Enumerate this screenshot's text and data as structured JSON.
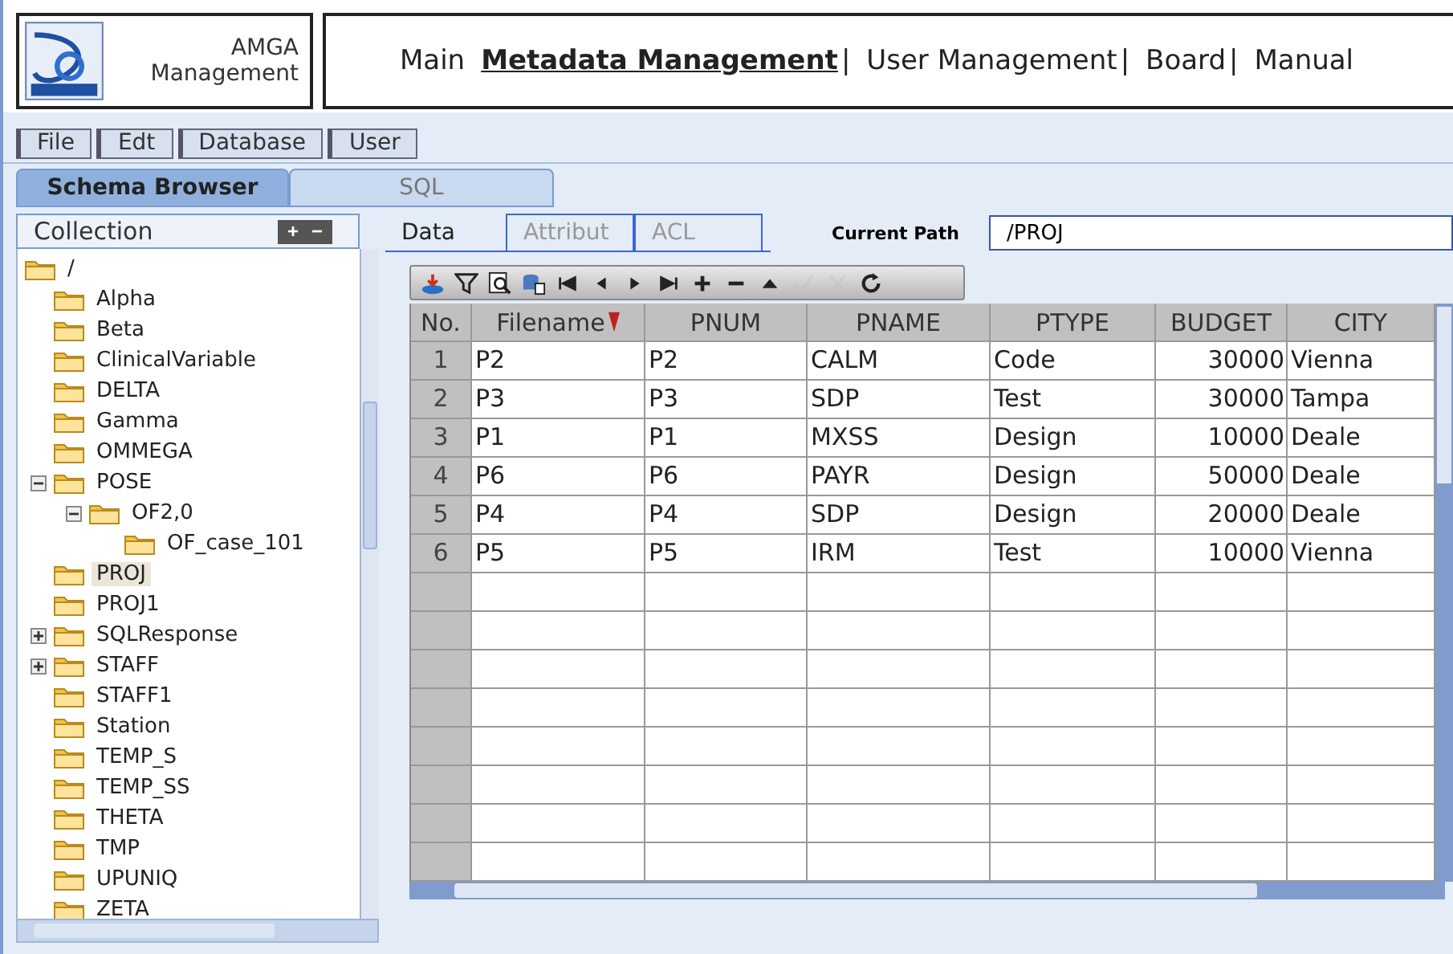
{
  "logo": {
    "title": "AMGA",
    "subtitle": "Management"
  },
  "nav": [
    {
      "kind": "link",
      "label": "Main",
      "selected": false
    },
    {
      "kind": "link",
      "label": "Metadata Management",
      "selected": true
    },
    {
      "kind": "separator",
      "label": "|"
    },
    {
      "kind": "link",
      "label": "User Management",
      "selected": false
    },
    {
      "kind": "separator",
      "label": "|"
    },
    {
      "kind": "link",
      "label": "Board",
      "selected": false
    },
    {
      "kind": "separator",
      "label": "|"
    },
    {
      "kind": "link",
      "label": "Manual",
      "selected": false
    }
  ],
  "menu": [
    "File",
    "Edt",
    "Database",
    "User"
  ],
  "tabs": [
    {
      "label": "Schema Browser",
      "selected": true
    },
    {
      "label": "SQL",
      "selected": false
    }
  ],
  "collection": {
    "title": "Collection",
    "expand_all": "+",
    "collapse_all": "−",
    "tree": [
      {
        "label": "/",
        "selected": false,
        "children": [
          {
            "label": "Alpha",
            "selected": false
          },
          {
            "label": "Beta",
            "selected": false
          },
          {
            "label": "ClinicalVariable",
            "selected": false
          },
          {
            "label": "DELTA",
            "selected": false
          },
          {
            "label": "Gamma",
            "selected": false
          },
          {
            "label": "OMMEGA",
            "selected": false
          },
          {
            "label": "POSE",
            "expanded": true,
            "selected": false,
            "children": [
              {
                "label": "OF2,0",
                "expanded": true,
                "selected": false,
                "children": [
                  {
                    "label": "OF_case_101",
                    "selected": false
                  }
                ]
              }
            ]
          },
          {
            "label": "PROJ",
            "selected": true
          },
          {
            "label": "PROJ1",
            "selected": false
          },
          {
            "label": "SQLResponse",
            "expanded": false,
            "selected": false
          },
          {
            "label": "STAFF",
            "expanded": false,
            "selected": false
          },
          {
            "label": "STAFF1",
            "selected": false
          },
          {
            "label": "Station",
            "selected": false
          },
          {
            "label": "TEMP_S",
            "selected": false
          },
          {
            "label": "TEMP_SS",
            "selected": false
          },
          {
            "label": "THETA",
            "selected": false
          },
          {
            "label": "TMP",
            "selected": false
          },
          {
            "label": "UPUNIQ",
            "selected": false
          },
          {
            "label": "ZETA",
            "selected": false
          }
        ]
      }
    ]
  },
  "subtabs": [
    {
      "label": "Data",
      "selected": true
    },
    {
      "label": "Attribut",
      "selected": false
    },
    {
      "label": "ACL",
      "selected": false
    }
  ],
  "path": {
    "label": "Current Path",
    "value": "/PROJ"
  },
  "toolbar": [
    {
      "kind": "import",
      "disabled": false
    },
    {
      "kind": "filter",
      "disabled": false
    },
    {
      "kind": "preview",
      "disabled": false
    },
    {
      "kind": "database",
      "disabled": false
    },
    {
      "kind": "first",
      "disabled": false
    },
    {
      "kind": "prev",
      "disabled": false
    },
    {
      "kind": "next",
      "disabled": false
    },
    {
      "kind": "last",
      "disabled": false
    },
    {
      "kind": "add",
      "disabled": false
    },
    {
      "kind": "remove",
      "disabled": false
    },
    {
      "kind": "up",
      "disabled": false
    },
    {
      "kind": "confirm",
      "disabled": true
    },
    {
      "kind": "cancel",
      "disabled": true
    },
    {
      "kind": "refresh",
      "disabled": false
    }
  ],
  "table": {
    "columns": [
      {
        "label": "No.",
        "sorted": false
      },
      {
        "label": "Filename",
        "sorted": true
      },
      {
        "label": "PNUM",
        "sorted": false
      },
      {
        "label": "PNAME",
        "sorted": false
      },
      {
        "label": "PTYPE",
        "sorted": false
      },
      {
        "label": "BUDGET",
        "sorted": false
      },
      {
        "label": "CITY",
        "sorted": false
      }
    ],
    "rows": [
      [
        "1",
        "P2",
        "P2",
        "CALM",
        "Code",
        "30000",
        "Vienna"
      ],
      [
        "2",
        "P3",
        "P3",
        "SDP",
        "Test",
        "30000",
        "Tampa"
      ],
      [
        "3",
        "P1",
        "P1",
        "MXSS",
        "Design",
        "10000",
        "Deale"
      ],
      [
        "4",
        "P6",
        "P6",
        "PAYR",
        "Design",
        "50000",
        "Deale"
      ],
      [
        "5",
        "P4",
        "P4",
        "SDP",
        "Design",
        "20000",
        "Deale"
      ],
      [
        "6",
        "P5",
        "P5",
        "IRM",
        "Test",
        "10000",
        "Vienna"
      ]
    ]
  }
}
